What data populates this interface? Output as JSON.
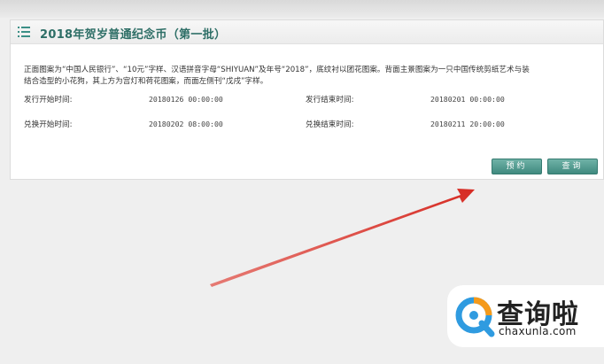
{
  "panel": {
    "title": "2018年贺岁普通纪念币（第一批）",
    "description_lines": [
      "正面图案为“中国人民银行”、“10元”字样、汉语拼音字母“SHIYUAN”及年号“2018”，底纹衬以团花图案。背面主景图案为一只中国传统剪纸艺术与装",
      "结合造型的小花狗，其上方为宫灯和荷花图案，而面左侧刊“戊戌”字样。"
    ],
    "fields": {
      "issue_start_label": "发行开始时间:",
      "issue_start_value": "20180126 00:00:00",
      "issue_end_label": "发行结束时间:",
      "issue_end_value": "20180201 00:00:00",
      "exchange_start_label": "兑换开始时间:",
      "exchange_start_value": "20180202 08:00:00",
      "exchange_end_label": "兑换结束时间:",
      "exchange_end_value": "20180211 20:00:00"
    },
    "buttons": {
      "reserve": "预约",
      "query": "查询"
    }
  },
  "watermark": {
    "brand_text": "查询啦",
    "url_text": "chaxunla.com"
  },
  "colors": {
    "accent": "#3f8a7f",
    "title": "#2d6e66",
    "arrow": "#d9342b"
  }
}
